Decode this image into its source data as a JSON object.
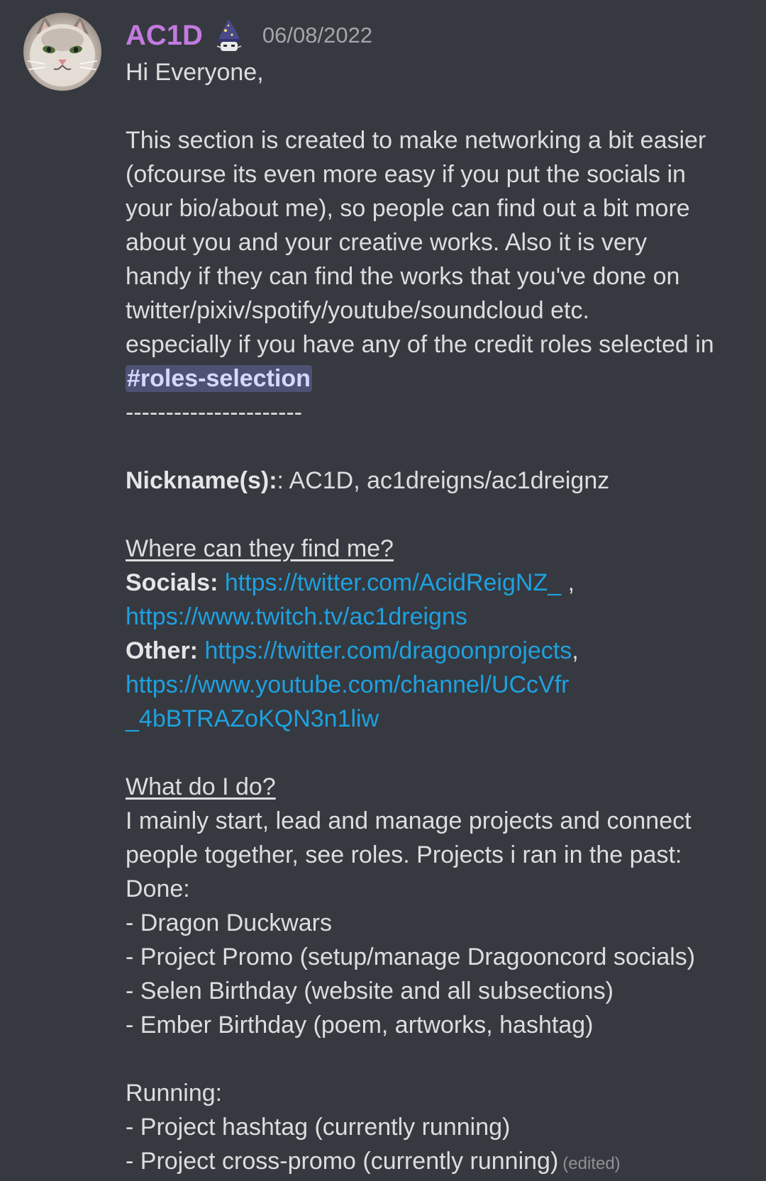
{
  "message": {
    "author": "AC1D",
    "timestamp": "06/08/2022",
    "avatar_icon": "cat-avatar-icon",
    "role_icon": "wizard-role-icon",
    "author_color": "#c27ae0",
    "greeting": "Hi Everyone,",
    "intro_lines": [
      "This section is created to make networking a bit easier",
      "(ofcourse its even more easy if you put the socials in",
      "your bio/about me), so people can find out a bit more",
      "about you and your creative works. Also it is very",
      "handy if they can find the works that you've done on",
      "twitter/pixiv/spotify/youtube/soundcloud etc.",
      "especially if you have any of the credit roles selected in"
    ],
    "channel_mention": "#roles-selection",
    "divider": "----------------------",
    "nickname_label": "Nickname(s):",
    "nickname_value": ": AC1D, ac1dreigns/ac1dreignz",
    "where_heading": "Where can they find me?",
    "socials_label": "Socials:",
    "social_link_1": "https://twitter.com/AcidReigNZ_",
    "social_sep": " ,",
    "social_link_2": "https://www.twitch.tv/ac1dreigns",
    "other_label": "Other:",
    "other_link_1": "https://twitter.com/dragoonprojects",
    "other_sep": ",",
    "other_link_2_line1": "https://www.youtube.com/channel/UCcVfr",
    "other_link_2_line2": "_4bBTRAZoKQN3n1liw",
    "what_heading": "What do I do?",
    "what_lines": [
      "I mainly start, lead and manage projects and connect",
      "people together, see roles. Projects i ran in the past:"
    ],
    "done_label": "Done:",
    "done_items": [
      "- Dragon Duckwars",
      "- Project Promo (setup/manage Dragooncord socials)",
      "- Selen Birthday (website and all subsections)",
      "- Ember Birthday (poem, artworks, hashtag)"
    ],
    "running_label": "Running:",
    "running_items": [
      "- Project hashtag (currently running)",
      "- Project cross-promo (currently running)"
    ],
    "edited_label": "(edited)"
  },
  "colors": {
    "background": "#36393f",
    "text": "#dcddde",
    "link": "#1ea1e0",
    "mention_bg": "#4d5274",
    "timestamp": "#a3a6aa"
  }
}
